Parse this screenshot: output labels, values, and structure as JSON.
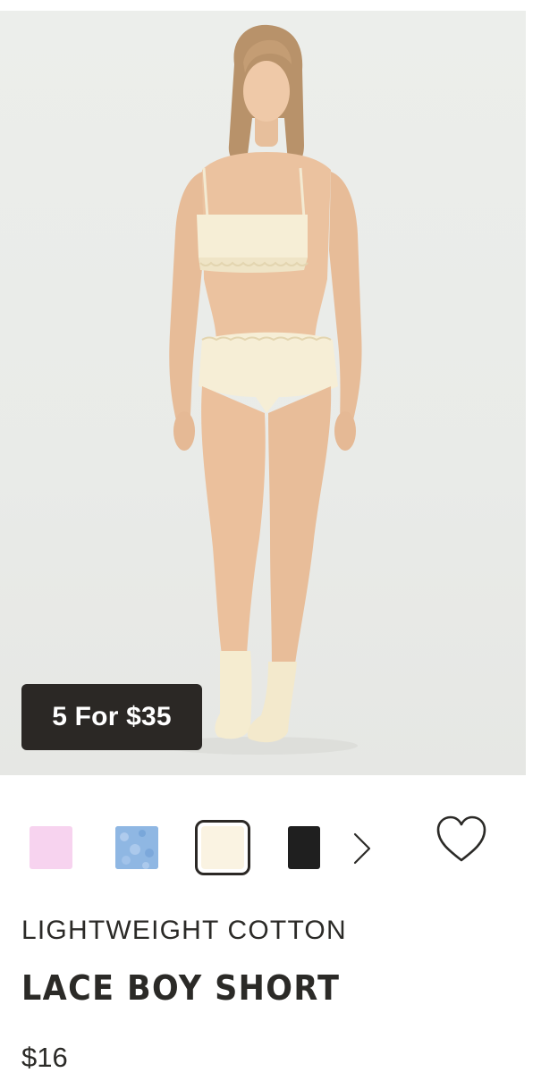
{
  "product": {
    "image_alt": "Model wearing cream lace boy short with matching bandeau bralette and cream socks",
    "promo_badge": "5 For $35",
    "subtitle": "LIGHTWEIGHT COTTON",
    "title": "LACE BOY SHORT",
    "price": "$16"
  },
  "swatches": [
    {
      "name": "pink",
      "color": "#f7d3ef",
      "selected": false
    },
    {
      "name": "blue-floral",
      "color": "#8fb7e3",
      "selected": false
    },
    {
      "name": "cream",
      "color": "#faf3e2",
      "selected": true
    },
    {
      "name": "black",
      "color": "#1f1f1f",
      "selected": false
    }
  ],
  "icons": {
    "next": "chevron-right-icon",
    "wishlist": "heart-outline-icon"
  },
  "colors": {
    "text": "#2b2a27",
    "badge_bg": "#2b2825",
    "image_bg": "#eceeeb"
  }
}
